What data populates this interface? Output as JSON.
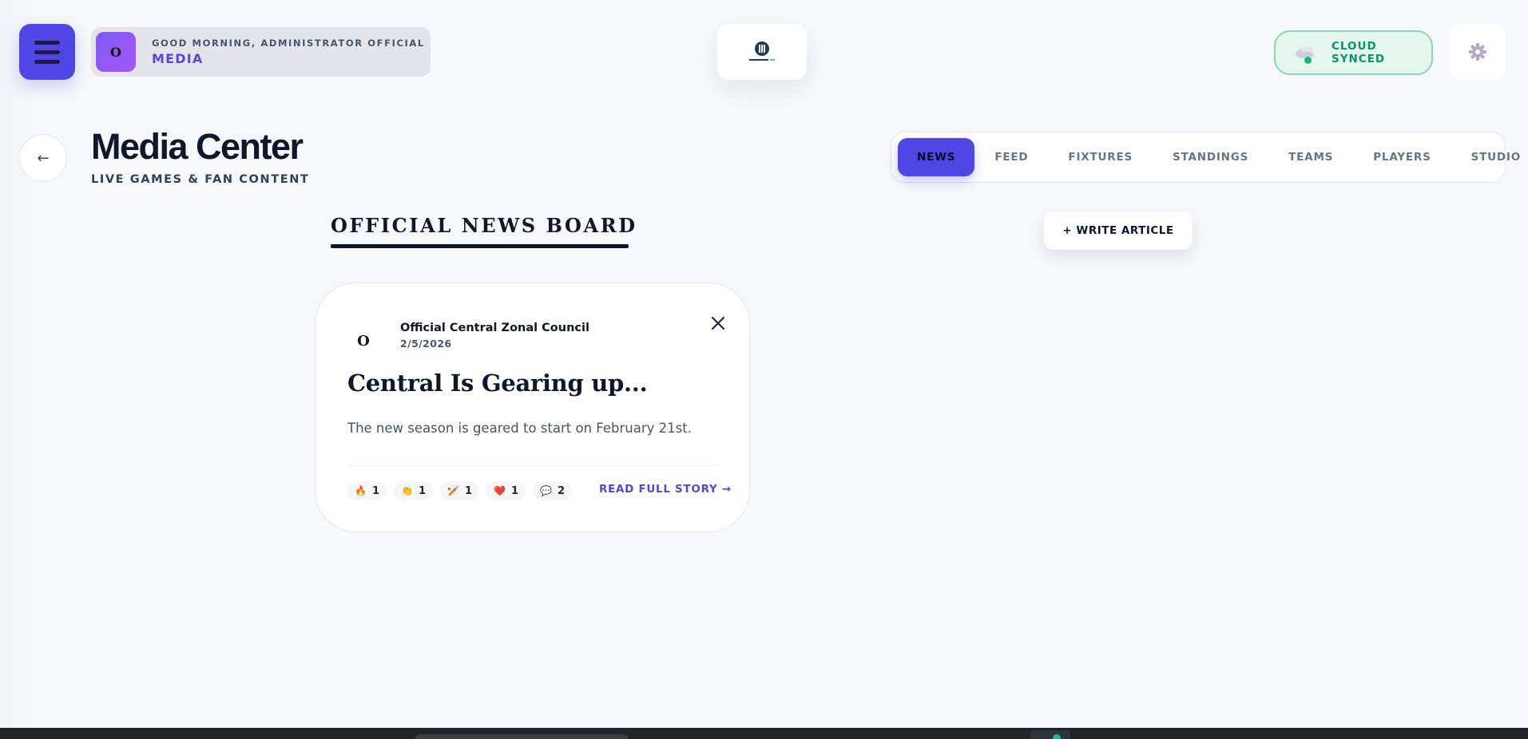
{
  "header": {
    "greeting": "GOOD MORNING, ADMINISTRATOR OFFICIAL",
    "role": "MEDIA",
    "avatar_initial": "O",
    "sync_status": "CLOUD SYNCED",
    "icons": {
      "menu": "hamburger-icon",
      "logo": "league-logo",
      "sync": "cloud-icon",
      "settings": "gear-icon"
    },
    "colors": {
      "accent": "#4f46e5",
      "sync": "#059669"
    }
  },
  "page": {
    "back_label": "←",
    "title": "Media Center",
    "subtitle": "LIVE GAMES & FAN CONTENT"
  },
  "tabs": [
    {
      "label": "NEWS",
      "active": true
    },
    {
      "label": "FEED",
      "active": false
    },
    {
      "label": "FIXTURES",
      "active": false
    },
    {
      "label": "STANDINGS",
      "active": false
    },
    {
      "label": "TEAMS",
      "active": false
    },
    {
      "label": "PLAYERS",
      "active": false
    },
    {
      "label": "STUDIO",
      "active": false
    }
  ],
  "board": {
    "title": "OFFICIAL NEWS BOARD",
    "write_label": "+ WRITE ARTICLE"
  },
  "article": {
    "author_initial": "O",
    "author": "Official Central Zonal Council",
    "date": "2/5/2026",
    "title": "Central Is Gearing up...",
    "excerpt": "The new season is geared to start on February 21st.",
    "reactions": [
      {
        "icon": "🔥",
        "name": "fire-reaction",
        "count": "1"
      },
      {
        "icon": "👏",
        "name": "clap-reaction",
        "count": "1"
      },
      {
        "icon": "🏏",
        "name": "cricket-reaction",
        "count": "1"
      },
      {
        "icon": "❤️",
        "name": "heart-reaction",
        "count": "1"
      },
      {
        "icon": "💬",
        "name": "comment-reaction",
        "count": "2"
      }
    ],
    "read_more": "READ FULL STORY →"
  }
}
